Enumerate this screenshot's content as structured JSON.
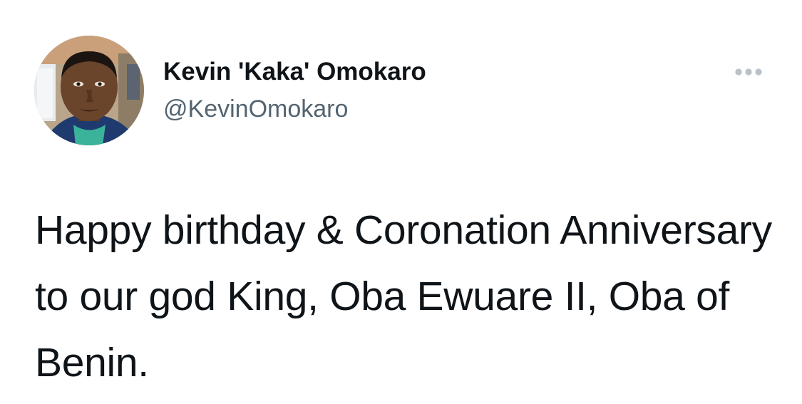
{
  "author": {
    "display_name": "Kevin 'Kaka' Omokaro",
    "handle": "@KevinOmokaro",
    "avatar_icon": "profile-photo"
  },
  "menu": {
    "icon": "more-options-icon"
  },
  "tweet": {
    "text": "Happy birthday & Coronation Anniversary to our god King, Oba Ewuare II, Oba of Benin."
  },
  "colors": {
    "text_primary": "#0f1419",
    "text_secondary": "#536471",
    "icon_gray": "#b9c1c9"
  }
}
